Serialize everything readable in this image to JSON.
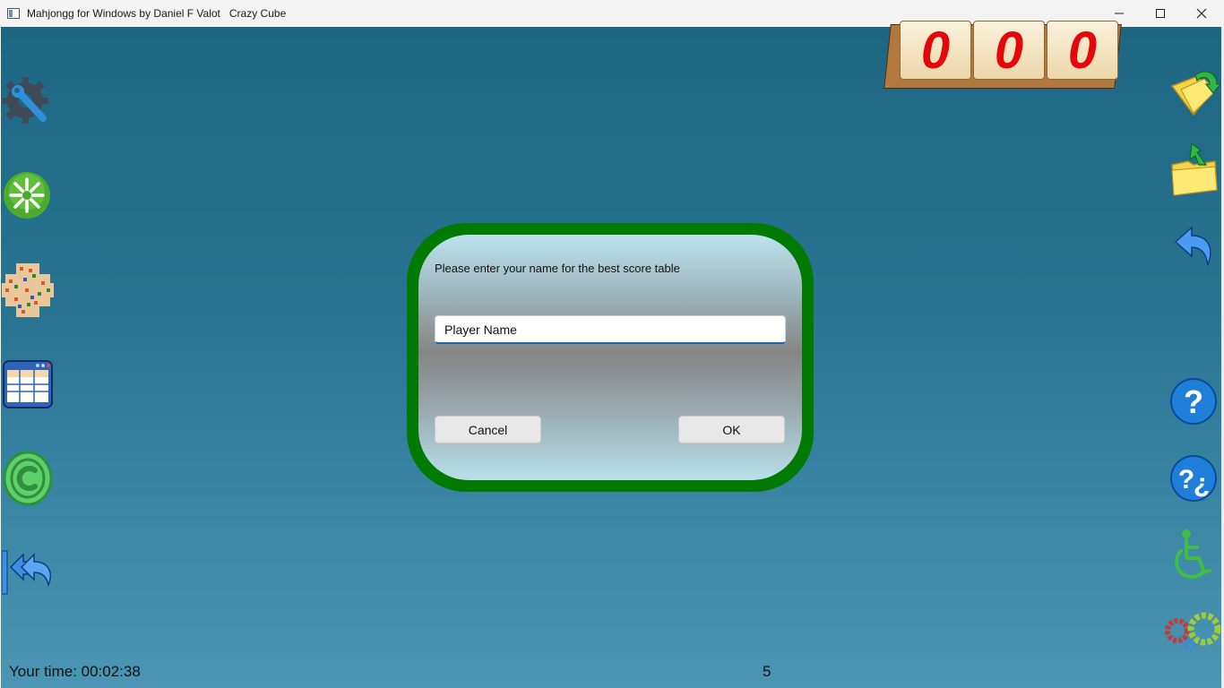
{
  "window": {
    "title": "Mahjongg for Windows by Daniel F Valot   Crazy Cube",
    "controls": [
      "minimize-icon",
      "maximize-icon",
      "close-icon"
    ]
  },
  "score_counter": {
    "digits": [
      "0",
      "0",
      "0"
    ],
    "digit_color": "#e3080b"
  },
  "left_toolbar": [
    "settings-wrench-icon",
    "new-game-starburst-icon",
    "tile-layout-icon",
    "score-table-icon",
    "copyright-icon",
    "back-to-start-icon"
  ],
  "right_toolbar": [
    "open-folder-icon",
    "save-folder-icon",
    "undo-arrow-icon",
    "help-icon",
    "help-spanish-icon",
    "accessibility-icon",
    "gears-icon"
  ],
  "dialog": {
    "message": "Please enter your name for the best score table",
    "name_input_value": "Player Name",
    "cancel_label": "Cancel",
    "ok_label": "OK",
    "frame_color": "#007a00"
  },
  "status": {
    "time_label": "Your time: 00:02:38",
    "count": "5"
  }
}
